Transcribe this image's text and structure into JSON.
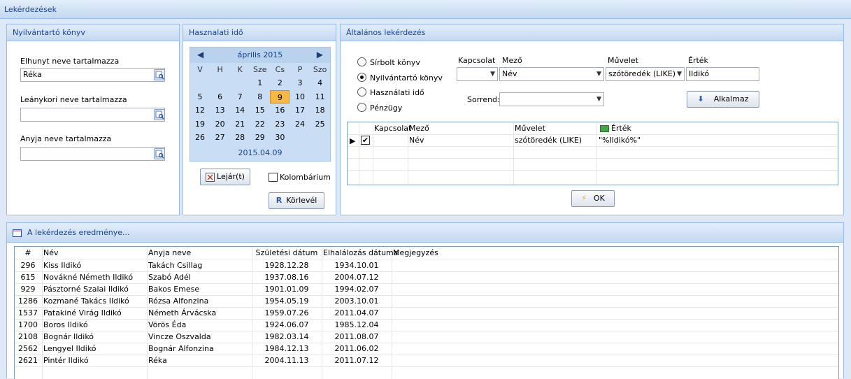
{
  "window": {
    "title": "Lekérdezések"
  },
  "registry_panel": {
    "title": "Nyilvántartó könyv",
    "fields": [
      {
        "label": "Elhunyt neve tartalmazza",
        "value": "Réka"
      },
      {
        "label": "Leánykori neve tartalmazza",
        "value": ""
      },
      {
        "label": "Anyja neve tartalmazza",
        "value": ""
      }
    ]
  },
  "usage_panel": {
    "title": "Hasznalati idő",
    "calendar": {
      "month_label": "április 2015",
      "weekdays": [
        "V",
        "H",
        "K",
        "Sze",
        "Cs",
        "P",
        "Szo"
      ],
      "weeks": [
        [
          "",
          "",
          "",
          "1",
          "2",
          "3",
          "4"
        ],
        [
          "5",
          "6",
          "7",
          "8",
          "9",
          "10",
          "11"
        ],
        [
          "12",
          "13",
          "14",
          "15",
          "16",
          "17",
          "18"
        ],
        [
          "19",
          "20",
          "21",
          "22",
          "23",
          "24",
          "25"
        ],
        [
          "26",
          "27",
          "28",
          "29",
          "30",
          "",
          ""
        ]
      ],
      "selected_day": "9",
      "footer_date": "2015.04.09"
    },
    "expired_button": "Lejár(t)",
    "columbarium_label": "Kolombárium",
    "columbarium_checked": false,
    "letter_button": "Körlevél"
  },
  "general_panel": {
    "title": "Általános lekérdezés",
    "radios": [
      {
        "label": "Sírbolt könyv",
        "checked": false
      },
      {
        "label": "Nyilvántartó könyv",
        "checked": true
      },
      {
        "label": "Használati idő",
        "checked": false
      },
      {
        "label": "Pénzügy",
        "checked": false
      }
    ],
    "col_headers": {
      "connection": "Kapcsolat",
      "field": "Mező",
      "operation": "Művelet",
      "value": "Érték"
    },
    "connection_value": "",
    "field_value": "Név",
    "operation_value": "szótöredék (LIKE)",
    "value_input": "Ildikó",
    "sort_label": "Sorrend:",
    "sort_value": "",
    "apply_button": "Alkalmaz",
    "criteria_grid": {
      "headers": [
        "Kapcsolat",
        "Mező",
        "Művelet",
        "Érték"
      ],
      "rows": [
        {
          "checked": true,
          "connection": "",
          "field": "Név",
          "operation": "szótöredék (LIKE)",
          "value": "\"%Ildikó%\""
        }
      ]
    },
    "ok_button": "OK"
  },
  "results_panel": {
    "title": "A lekérdezés eredménye...",
    "headers": [
      "#",
      "Név",
      "Anyja neve",
      "Születési dátum",
      "Elhalálozás dátuma",
      "Megjegyzés"
    ],
    "rows": [
      [
        "296",
        "Kiss Ildikó",
        "Takách Csillag",
        "1928.12.28",
        "1934.10.01",
        ""
      ],
      [
        "615",
        "Novákné Németh Ildikó",
        "Szabó Adél",
        "1937.08.16",
        "2004.07.12",
        ""
      ],
      [
        "929",
        "Pásztorné Szalai Ildikó",
        "Bakos Emese",
        "1901.01.09",
        "1994.02.07",
        ""
      ],
      [
        "1286",
        "Kozmané Takács Ildikó",
        "Rózsa Alfonzina",
        "1954.05.19",
        "2003.10.01",
        ""
      ],
      [
        "1537",
        "Patakiné Virág Ildikó",
        "Németh Árvácska",
        "1959.07.26",
        "2011.04.07",
        ""
      ],
      [
        "1700",
        "Boros Ildikó",
        "Vörös Éda",
        "1924.06.07",
        "1985.12.04",
        ""
      ],
      [
        "2108",
        "Bognár Ildikó",
        "Vincze Oszvalda",
        "1982.03.14",
        "2011.08.07",
        ""
      ],
      [
        "2562",
        "Lengyel Ildikó",
        "Bognár Alfonzina",
        "1984.12.13",
        "2011.06.02",
        ""
      ],
      [
        "2621",
        "Pintér Ildikó",
        "Réka",
        "2004.11.13",
        "2011.07.12",
        ""
      ]
    ]
  },
  "colors": {
    "panel_header_text": "#15428b",
    "border": "#99bbe8",
    "today": "#f7b844"
  }
}
